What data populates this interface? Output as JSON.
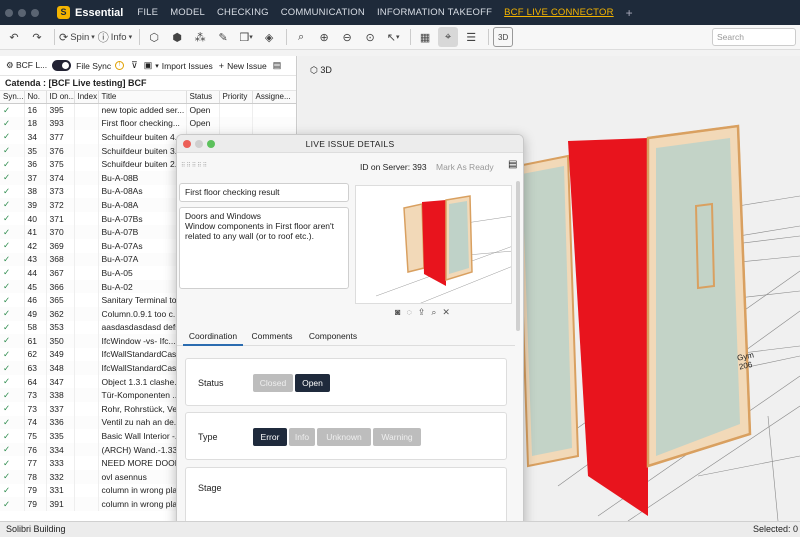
{
  "app": {
    "name": "Essential",
    "logo_letter": "S"
  },
  "menu": [
    "FILE",
    "MODEL",
    "CHECKING",
    "COMMUNICATION",
    "INFORMATION TAKEOFF",
    "BCF LIVE CONNECTOR"
  ],
  "menu_add": "+",
  "toolbar": {
    "spin_label": "Spin",
    "info_label": "Info",
    "search_placeholder": "Search",
    "view3d_label": "3D"
  },
  "viewport": {
    "view_label": "3D",
    "room_label": "Gym",
    "room_number": "206"
  },
  "left_panel": {
    "tab_label": "BCF L...",
    "file_sync_label": "File Sync",
    "import_label": "Import Issues",
    "new_issue_label": "New Issue",
    "project_title": "Catenda : [BCF Live testing] BCF",
    "columns": [
      "Syn...",
      "No.",
      "ID on...",
      "Index",
      "Title",
      "Status",
      "Priority",
      "Assigne..."
    ],
    "rows": [
      {
        "no": "16",
        "id": "395",
        "title": "new topic added ser...",
        "status": "Open"
      },
      {
        "no": "18",
        "id": "393",
        "title": "First floor checking...",
        "status": "Open"
      },
      {
        "no": "34",
        "id": "377",
        "title": "Schuifdeur buiten 4...",
        "status": ""
      },
      {
        "no": "35",
        "id": "376",
        "title": "Schuifdeur buiten 3...",
        "status": ""
      },
      {
        "no": "36",
        "id": "375",
        "title": "Schuifdeur buiten 2...",
        "status": ""
      },
      {
        "no": "37",
        "id": "374",
        "title": "Bu-A-08B",
        "status": ""
      },
      {
        "no": "38",
        "id": "373",
        "title": "Bu-A-08As",
        "status": ""
      },
      {
        "no": "39",
        "id": "372",
        "title": "Bu-A-08A",
        "status": ""
      },
      {
        "no": "40",
        "id": "371",
        "title": "Bu-A-07Bs",
        "status": ""
      },
      {
        "no": "41",
        "id": "370",
        "title": "Bu-A-07B",
        "status": ""
      },
      {
        "no": "42",
        "id": "369",
        "title": "Bu-A-07As",
        "status": ""
      },
      {
        "no": "43",
        "id": "368",
        "title": "Bu-A-07A",
        "status": ""
      },
      {
        "no": "44",
        "id": "367",
        "title": "Bu-A-05",
        "status": ""
      },
      {
        "no": "45",
        "id": "366",
        "title": "Bu-A-02",
        "status": ""
      },
      {
        "no": "46",
        "id": "365",
        "title": "Sanitary Terminal to...",
        "status": ""
      },
      {
        "no": "49",
        "id": "362",
        "title": "Column.0.9.1 too c...",
        "status": ""
      },
      {
        "no": "58",
        "id": "353",
        "title": "aasdasdasdasd defs...",
        "status": ""
      },
      {
        "no": "61",
        "id": "350",
        "title": "IfcWindow -vs- Ifc...",
        "status": ""
      },
      {
        "no": "62",
        "id": "349",
        "title": "IfcWallStandardCas...",
        "status": ""
      },
      {
        "no": "63",
        "id": "348",
        "title": "IfcWallStandardCas...",
        "status": ""
      },
      {
        "no": "64",
        "id": "347",
        "title": "Object 1.3.1 clashe...",
        "status": ""
      },
      {
        "no": "73",
        "id": "338",
        "title": "Tür-Komponenten ...",
        "status": ""
      },
      {
        "no": "73",
        "id": "337",
        "title": "Rohr, Rohrstück, Ve...",
        "status": ""
      },
      {
        "no": "74",
        "id": "336",
        "title": "Ventil zu nah an de...",
        "status": ""
      },
      {
        "no": "75",
        "id": "335",
        "title": "Basic Wall Interior -...",
        "status": ""
      },
      {
        "no": "76",
        "id": "334",
        "title": "(ARCH) Wand.-1.33...",
        "status": ""
      },
      {
        "no": "77",
        "id": "333",
        "title": "NEED MORE DOOR",
        "status": ""
      },
      {
        "no": "78",
        "id": "332",
        "title": "ovl asennus",
        "status": ""
      },
      {
        "no": "79",
        "id": "331",
        "title": "column in wrong pla...",
        "status": ""
      },
      {
        "no": "79",
        "id": "391",
        "title": "column in wrong pla...",
        "status": ""
      }
    ]
  },
  "dialog": {
    "title": "LIVE ISSUE DETAILS",
    "server_id_label": "ID on Server: 393",
    "mark_ready_label": "Mark As Ready",
    "issue_title": "First floor checking result",
    "description_line1": "Doors and Windows",
    "description_line2": "Window components in First floor aren't related to any wall (or to roof etc.).",
    "tabs": [
      "Coordination",
      "Comments",
      "Components"
    ],
    "status_label": "Status",
    "status_options": [
      "Closed",
      "Open"
    ],
    "status_selected": "Open",
    "type_label": "Type",
    "type_options": [
      "Error",
      "Info",
      "Unknown",
      "Warning"
    ],
    "type_selected": "Error",
    "stage_label": "Stage"
  },
  "statusbar": {
    "left": "Solibri Building",
    "right": "Selected: 0"
  },
  "colors": {
    "menubar": "#1e2a3a",
    "accent": "#f4b400",
    "selected_pill": "#1f2a3c",
    "red_panel": "#e8141d",
    "door_frame": "#e8b070"
  }
}
